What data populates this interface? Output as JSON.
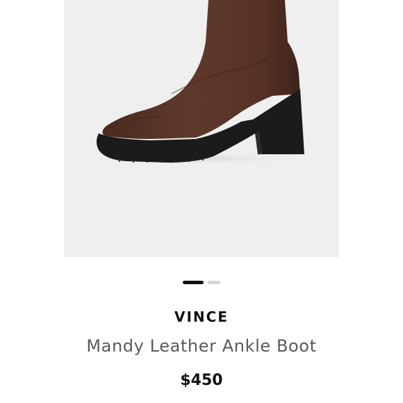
{
  "product": {
    "image_icon": "ankle-boot-image",
    "brand": "VINCE",
    "name": "Mandy Leather Ankle Boot",
    "price": "$450"
  },
  "carousel": {
    "total_slides": 2,
    "active_slide": 1
  },
  "colors": {
    "image_background": "#efefef",
    "boot_leather": "#5a3428",
    "boot_sole": "#1b1b1b",
    "active_dot": "#111111",
    "inactive_dot": "#d4d4d4"
  }
}
